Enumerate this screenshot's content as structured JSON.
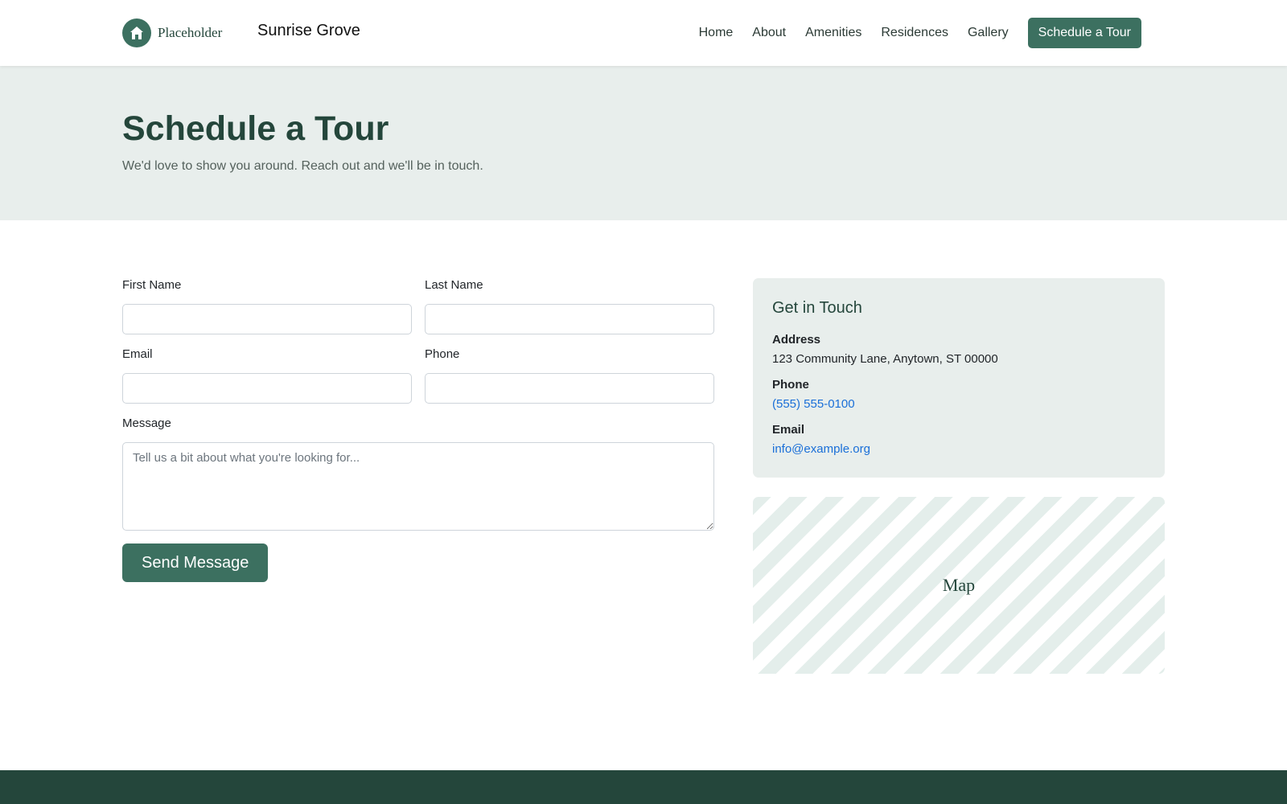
{
  "header": {
    "logo_text": "Placeholder",
    "brand": "Sunrise Grove",
    "nav": [
      {
        "label": "Home"
      },
      {
        "label": "About"
      },
      {
        "label": "Amenities"
      },
      {
        "label": "Residences"
      },
      {
        "label": "Gallery"
      }
    ],
    "cta_label": "Schedule a Tour"
  },
  "hero": {
    "title": "Schedule a Tour",
    "subtitle": "We'd love to show you around. Reach out and we'll be in touch."
  },
  "form": {
    "first_name": {
      "label": "First Name",
      "value": "",
      "placeholder": ""
    },
    "last_name": {
      "label": "Last Name",
      "value": "",
      "placeholder": ""
    },
    "email": {
      "label": "Email",
      "value": "",
      "placeholder": ""
    },
    "phone": {
      "label": "Phone",
      "value": "",
      "placeholder": ""
    },
    "message": {
      "label": "Message",
      "value": "",
      "placeholder": "Tell us a bit about what you're looking for..."
    },
    "submit_label": "Send Message"
  },
  "contact": {
    "title": "Get in Touch",
    "address_label": "Address",
    "address_value": "123 Community Lane, Anytown, ST 00000",
    "phone_label": "Phone",
    "phone_value": "(555) 555-0100",
    "email_label": "Email",
    "email_value": "info@example.org"
  },
  "map": {
    "label": "Map"
  },
  "colors": {
    "primary": "#3c7060",
    "dark": "#24463b",
    "tint": "#e8eeec",
    "link": "#1a6fd8"
  },
  "icons": {
    "logo": "home-icon"
  }
}
